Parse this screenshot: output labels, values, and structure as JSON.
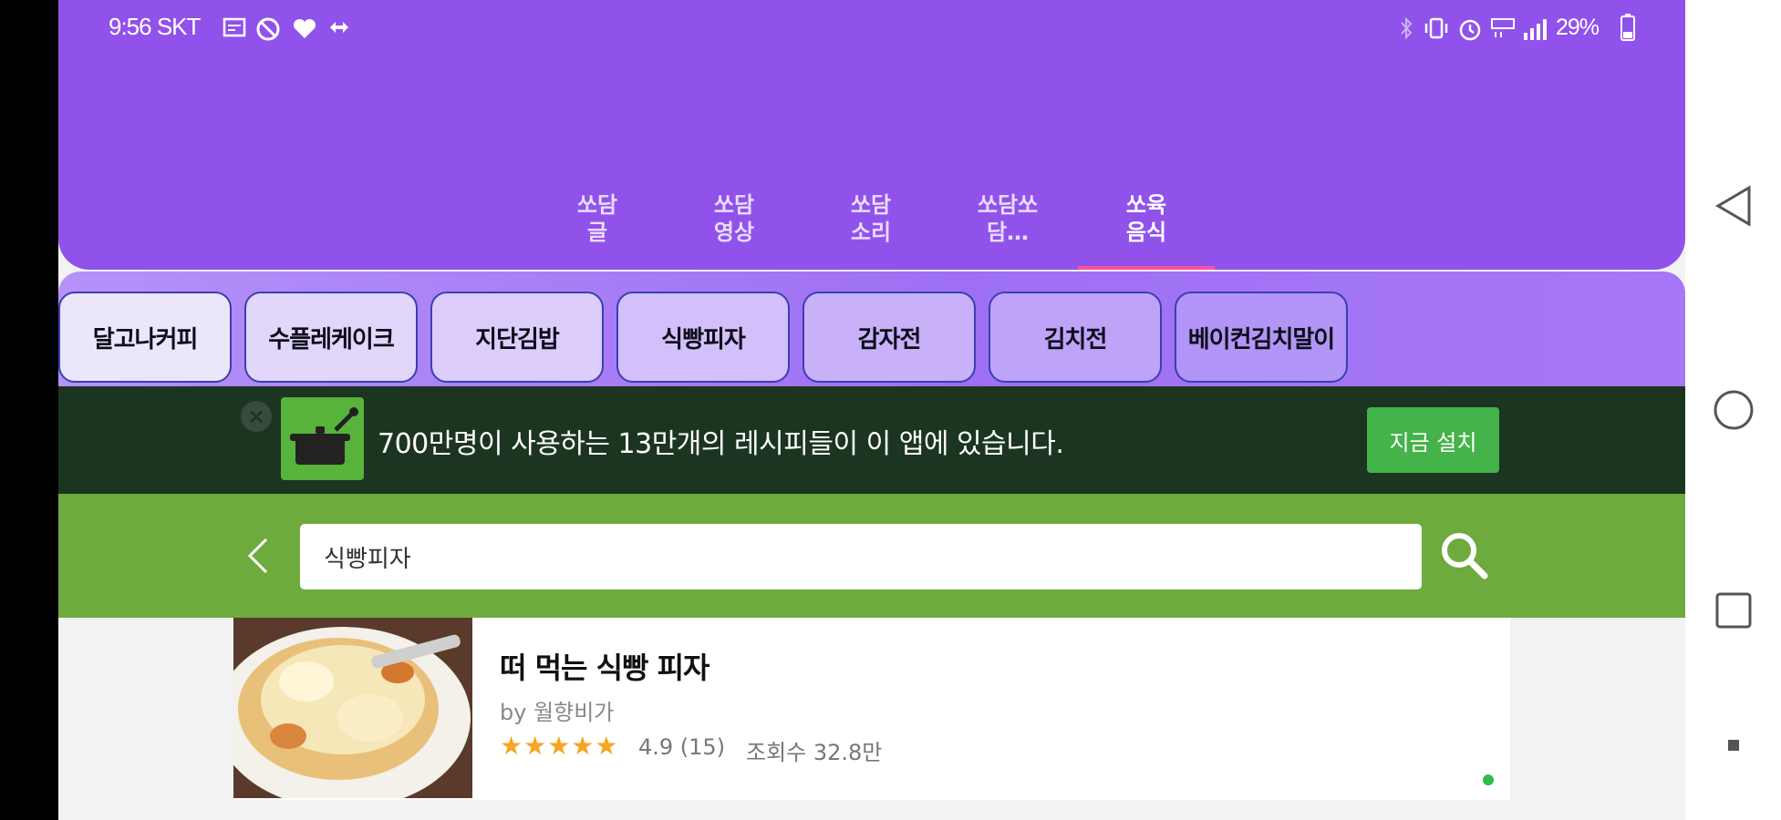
{
  "status_bar": {
    "time_carrier": "9:56 SKT",
    "battery": "29%"
  },
  "top_tabs": [
    {
      "label": "쏘담\n글",
      "active": false
    },
    {
      "label": "쏘담\n영상",
      "active": false
    },
    {
      "label": "쏘담\n소리",
      "active": false
    },
    {
      "label": "쏘담쏘\n담…",
      "active": false
    },
    {
      "label": "쏘육\n음식",
      "active": true
    }
  ],
  "chips": [
    {
      "label": "달고나커피"
    },
    {
      "label": "수플레케이크"
    },
    {
      "label": "지단김밥"
    },
    {
      "label": "식빵피자"
    },
    {
      "label": "감자전"
    },
    {
      "label": "김치전"
    },
    {
      "label": "베이컨김치말이"
    }
  ],
  "promo": {
    "text": "700만명이 사용하는 13만개의 레시피들이 이 앱에 있습니다.",
    "install_label": "지금 설치"
  },
  "search": {
    "value": "식빵피자"
  },
  "result": {
    "title": "떠 먹는 식빵 피자",
    "author": "by 월향비가",
    "stars": "★★★★★",
    "rating": "4.9 (15)",
    "views": "조회수 32.8만"
  },
  "colors": {
    "header_purple": "#9152eb",
    "banner_dark_green": "#1c3521",
    "install_green": "#44b34a",
    "search_green": "#6eab3e",
    "tab_indicator": "#ff4fa3",
    "star_orange": "#f5a623"
  },
  "icons": {
    "status_left": [
      "message-icon",
      "no-disturb-icon",
      "heart-icon",
      "sync-icon"
    ],
    "status_right": [
      "bluetooth-icon",
      "vibrate-icon",
      "alarm-icon",
      "volte-icon",
      "signal-icon",
      "battery-icon"
    ],
    "nav": [
      "back-triangle-icon",
      "home-circle-icon",
      "recent-square-icon",
      "dot-icon"
    ]
  }
}
